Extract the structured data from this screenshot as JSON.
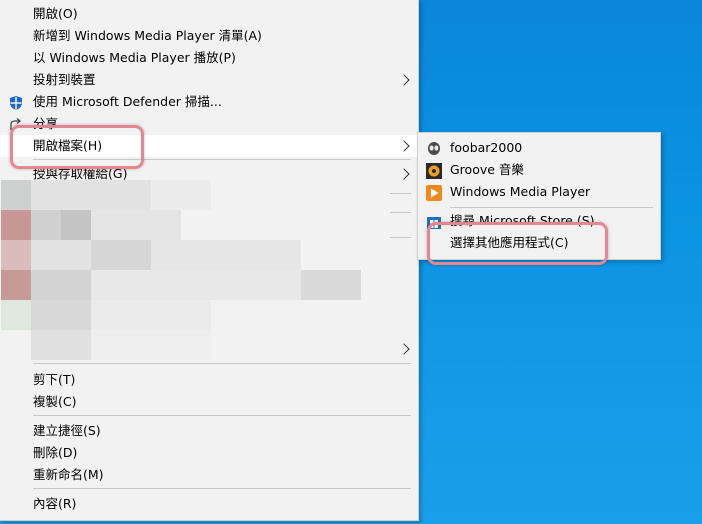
{
  "main_menu": {
    "items": [
      {
        "label": "開啟(O)"
      },
      {
        "label": "新增到 Windows Media Player 清單(A)"
      },
      {
        "label": "以 Windows Media Player 播放(P)"
      },
      {
        "label": "投射到裝置"
      },
      {
        "label": "使用 Microsoft Defender 掃描..."
      },
      {
        "label": "分享"
      },
      {
        "label": "開啟檔案(H)"
      },
      {
        "label": "授與存取權給(G)"
      },
      {
        "label": "剪下(T)"
      },
      {
        "label": "複製(C)"
      },
      {
        "label": "建立捷徑(S)"
      },
      {
        "label": "刪除(D)"
      },
      {
        "label": "重新命名(M)"
      },
      {
        "label": "內容(R)"
      }
    ]
  },
  "open_with_submenu": {
    "items": [
      {
        "label": "foobar2000",
        "icon": "foobar2000-icon"
      },
      {
        "label": "Groove 音樂",
        "icon": "groove-music-icon"
      },
      {
        "label": "Windows Media Player",
        "icon": "windows-media-player-icon"
      },
      {
        "label": "搜尋 Microsoft Store (S)",
        "icon": "microsoft-store-icon"
      },
      {
        "label": "選擇其他應用程式(C)"
      }
    ]
  },
  "colors": {
    "highlight_ring": "#e78590",
    "desktop_blue": "#0b8fe0",
    "menu_bg": "#f2f2f2"
  }
}
